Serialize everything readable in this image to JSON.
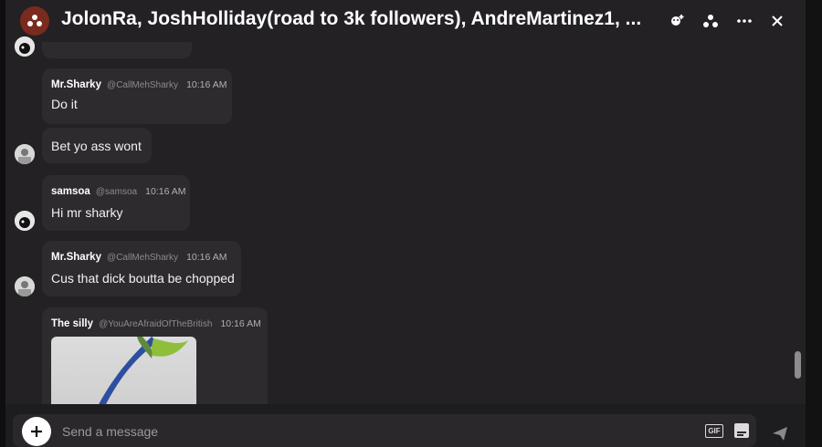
{
  "header": {
    "title": "JolonRa, JoshHolliday(road to 3k followers), AndreMartinez1, ...",
    "icons": [
      "group-icon",
      "add-person-icon",
      "members-icon",
      "more-icon",
      "close-icon"
    ]
  },
  "messages": [
    {
      "author": "Mr.Sharky",
      "handle": "@CallMehSharky",
      "time": "10:16 AM",
      "text": "Do it"
    },
    {
      "author": "",
      "handle": "",
      "time": "",
      "text": "Bet yo ass wont"
    },
    {
      "author": "samsoa",
      "handle": "@samsoa",
      "time": "10:16 AM",
      "text": "Hi mr sharky"
    },
    {
      "author": "Mr.Sharky",
      "handle": "@CallMehSharky",
      "time": "10:16 AM",
      "text": "Cus that dick boutta be chopped"
    },
    {
      "author": "The silly",
      "handle": "@YouAreAfraidOfTheBritish",
      "time": "10:16 AM",
      "text": ""
    }
  ],
  "composer": {
    "placeholder": "Send a message",
    "gif_label": "GIF"
  },
  "colors": {
    "panel": "#232124",
    "bubble": "#2d2b2e",
    "group_icon": "#7a2a1e"
  }
}
